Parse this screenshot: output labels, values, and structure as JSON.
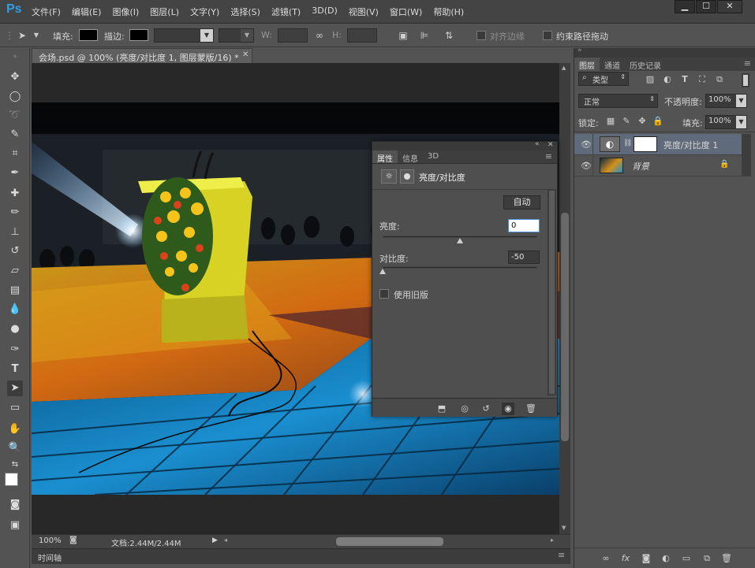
{
  "app": {
    "logo": "Ps"
  },
  "menu": [
    "文件(F)",
    "编辑(E)",
    "图像(I)",
    "图层(L)",
    "文字(Y)",
    "选择(S)",
    "滤镜(T)",
    "3D(D)",
    "视图(V)",
    "窗口(W)",
    "帮助(H)"
  ],
  "window_buttons": {
    "minimize": "▁",
    "maximize": "☐",
    "close": "✕"
  },
  "options": {
    "fill_label": "填充:",
    "stroke_label": "描边:",
    "w_label": "W:",
    "h_label": "H:",
    "align_edges": "对齐边缘",
    "constrain_path": "约束路径拖动"
  },
  "document": {
    "tab_title": "会场.psd @ 100% (亮度/对比度 1, 图层蒙版/16) *",
    "zoom": "100%",
    "doc_info": "文档:2.44M/2.44M",
    "timeline_label": "时间轴"
  },
  "properties": {
    "tabs": [
      "属性",
      "信息",
      "3D"
    ],
    "title": "亮度/对比度",
    "auto_button": "自动",
    "brightness_label": "亮度:",
    "brightness_value": "0",
    "contrast_label": "对比度:",
    "contrast_value": "-50",
    "legacy_label": "使用旧版",
    "brightness_level": 0.0,
    "contrast_level": -50
  },
  "layers_panel": {
    "tabs": [
      "图层",
      "通道",
      "历史记录"
    ],
    "filter_kind": "类型",
    "blend_mode": "正常",
    "opacity_label": "不透明度:",
    "opacity_value": "100%",
    "lock_label": "锁定:",
    "fill_label": "填充:",
    "fill_value": "100%",
    "layers": [
      {
        "name": "亮度/对比度 1",
        "selected": true
      },
      {
        "name": "背景",
        "selected": false
      }
    ]
  },
  "colors": {
    "accent_ps": "#2f9fe8",
    "panel_bg": "#535353",
    "layer_selected": "#5f6a7a"
  }
}
